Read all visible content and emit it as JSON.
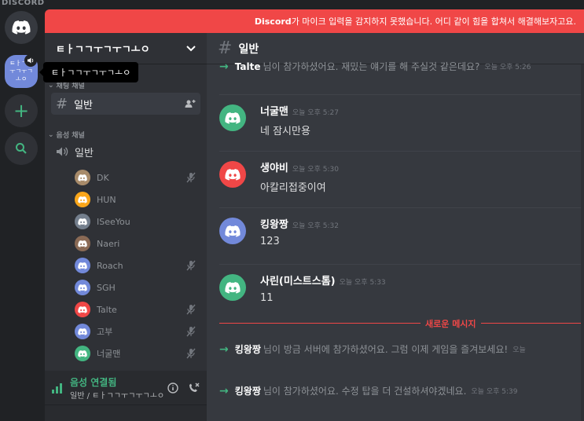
{
  "brand": "DISCORD",
  "notice": {
    "prefix": "Discord",
    "text": "가 마이크 입력을 감지하지 못했습니다. 어디 같이 힘을 합쳐서 해결해보자고요."
  },
  "server": {
    "name": "ㅌㅏㄱㄱㅜㄱㅜㄱㅗㅇ",
    "icon_text": "ㅌㅏㄱㄱ ㅜㄱㅜㄱㅗㅇ",
    "tooltip": "ㅌㅏㄱㄱㅜㄱㅜㄱㅗㅇ"
  },
  "sidebar": {
    "text_category": "채팅 채널",
    "text_channel": "일반",
    "voice_category": "음성 채널",
    "voice_channel": "일반",
    "voice_users": [
      {
        "name": "DK",
        "color": "#a88b6a",
        "muted": true
      },
      {
        "name": "HUN",
        "color": "#faa61a",
        "muted": false
      },
      {
        "name": "ISeeYou",
        "color": "#747f8d",
        "muted": false
      },
      {
        "name": "Naeri",
        "color": "#8a6a55",
        "muted": false
      },
      {
        "name": "Roach",
        "color": "#7289da",
        "muted": true
      },
      {
        "name": "SGH",
        "color": "#7289da",
        "muted": false
      },
      {
        "name": "Talte",
        "color": "#f04747",
        "muted": true
      },
      {
        "name": "고부",
        "color": "#7289da",
        "muted": true
      },
      {
        "name": "너굴맨",
        "color": "#43b581",
        "muted": true
      }
    ]
  },
  "voice_panel": {
    "status": "음성 연결됨",
    "location": "일반 / ㅌㅏㄱㄱㅜㄱㅜㄱㅗㅇ"
  },
  "chat": {
    "channel": "일반",
    "top_system": {
      "who": "Talte",
      "text": "님이 참가하셨어요. 재밌는 얘기를 해 주실것 같은데요?",
      "time": "오늘 오후 5:26"
    },
    "messages": [
      {
        "author": "너굴맨",
        "time": "오늘 오후 5:27",
        "text": "네 잠시만용",
        "color": "#43b581"
      },
      {
        "author": "생야비",
        "time": "오늘 오후 5:30",
        "text": "아칼리접중이여",
        "color": "#f04747"
      },
      {
        "author": "킹왕짱",
        "time": "오늘 오후 5:32",
        "text": "123",
        "color": "#7289da"
      },
      {
        "author": "사린(미스트스톰)",
        "time": "오늘 오후 5:33",
        "text": "11",
        "color": "#43b581"
      }
    ],
    "new_messages": "새로운 메시지",
    "system": [
      {
        "who": "킹왕짱",
        "text": "님이 방금 서버에 참가하셨어요. 그럼 이제 게임을 즐겨보세요!",
        "time": "오늘"
      },
      {
        "who": "킹왕짱",
        "text": "님이 참가하셨어요. 수정 탑을 더 건설하셔야겠네요.",
        "time": "오늘 오후 5:39"
      }
    ]
  },
  "colors": {
    "accent": "#7289da",
    "green": "#43b581",
    "red": "#f04747"
  }
}
